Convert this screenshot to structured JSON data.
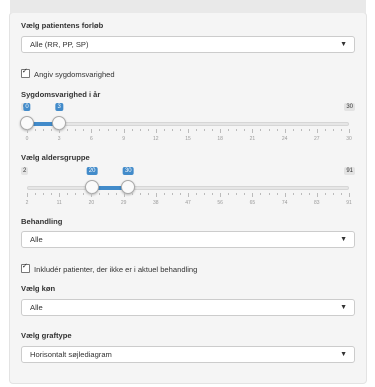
{
  "course": {
    "label": "Vælg patientens forløb",
    "selected": "Alle (RR, PP, SP)"
  },
  "duration_toggle": {
    "label": "Angiv sygdomsvarighed",
    "checked": true
  },
  "duration_slider": {
    "label": "Sygdomsvarighed i år",
    "min": 0,
    "max": 30,
    "value_low": 0,
    "value_high": 3,
    "min_label": "0",
    "max_label": "30",
    "low_label": "0",
    "high_label": "3",
    "ticks": [
      "0",
      "3",
      "6",
      "9",
      "12",
      "15",
      "18",
      "21",
      "24",
      "27",
      "30"
    ]
  },
  "age_slider": {
    "label": "Vælg aldersgruppe",
    "min": 2,
    "max": 91,
    "value_low": 20,
    "value_high": 30,
    "min_label": "2",
    "max_label": "91",
    "low_label": "20",
    "high_label": "30",
    "ticks": [
      "2",
      "11",
      "20",
      "29",
      "38",
      "47",
      "56",
      "65",
      "74",
      "83",
      "91"
    ]
  },
  "treatment": {
    "label": "Behandling",
    "selected": "Alle"
  },
  "include_inactive": {
    "label": "Inkludér patienter, der ikke er i aktuel behandling",
    "checked": true
  },
  "gender": {
    "label": "Vælg køn",
    "selected": "Alle"
  },
  "graph_type": {
    "label": "Vælg graftype",
    "selected": "Horisontalt søjlediagram"
  },
  "colors": {
    "accent": "#428bca",
    "panel_bg": "#f5f5f5"
  }
}
